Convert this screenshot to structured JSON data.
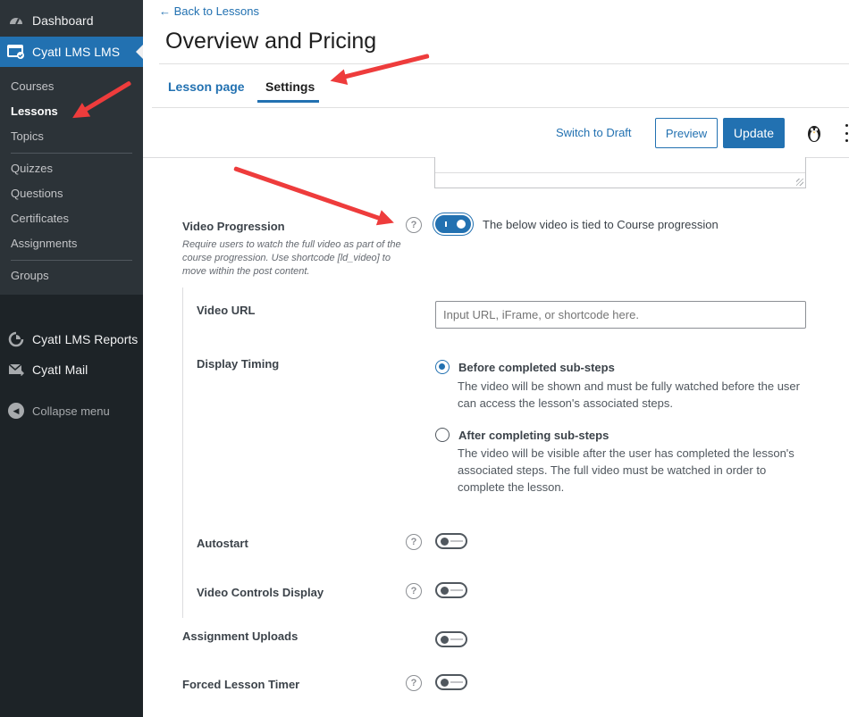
{
  "sidebar": {
    "dashboard": "Dashboard",
    "lms_menu": "CyatI LMS LMS",
    "submenu": [
      "Courses",
      "Lessons",
      "Topics",
      "Quizzes",
      "Questions",
      "Certificates",
      "Assignments",
      "Groups"
    ],
    "current_item": "Lessons",
    "reports": "CyatI LMS Reports",
    "mail": "CyatI Mail",
    "collapse": "Collapse menu"
  },
  "header": {
    "back_link": "← Back to Lessons",
    "title": "Overview and Pricing",
    "tabs": [
      "Lesson page",
      "Settings"
    ],
    "active_tab": "Settings",
    "switch_draft": "Switch to Draft",
    "preview": "Preview",
    "update": "Update"
  },
  "settings": {
    "video_progression": {
      "label": "Video Progression",
      "description": "Require users to watch the full video as part of the course progression. Use shortcode [ld_video] to move within the post content.",
      "enabled": true,
      "toggle_text": "The below video is tied to Course progression"
    },
    "video_url": {
      "label": "Video URL",
      "placeholder": "Input URL, iFrame, or shortcode here."
    },
    "display_timing": {
      "label": "Display Timing",
      "options": [
        {
          "title": "Before completed sub-steps",
          "description": "The video will be shown and must be fully watched before the user can access the lesson's associated steps.",
          "selected": true
        },
        {
          "title": "After completing sub-steps",
          "description": "The video will be visible after the user has completed the lesson's associated steps. The full video must be watched in order to complete the lesson.",
          "selected": false
        }
      ]
    },
    "autostart": {
      "label": "Autostart",
      "enabled": false
    },
    "video_controls": {
      "label": "Video Controls Display",
      "enabled": false
    },
    "assignment_uploads": {
      "label": "Assignment Uploads",
      "enabled": false
    },
    "forced_timer": {
      "label": "Forced Lesson Timer",
      "enabled": false
    }
  },
  "help_glyph": "?",
  "colors": {
    "accent": "#2271b1",
    "sidebar_bg": "#1d2327",
    "annotation_arrow": "#ee3c3c"
  }
}
